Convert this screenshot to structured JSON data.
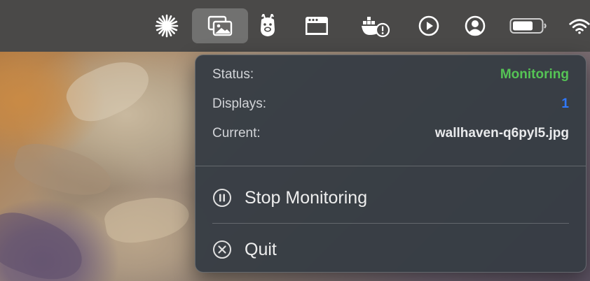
{
  "menubar": {
    "icons": [
      {
        "name": "asterisk-icon"
      },
      {
        "name": "wallpaper-app-icon",
        "active": true
      },
      {
        "name": "llama-icon"
      },
      {
        "name": "window-bar-icon"
      },
      {
        "name": "docker-warning-icon"
      },
      {
        "name": "play-circle-icon"
      },
      {
        "name": "user-circle-icon"
      },
      {
        "name": "battery-icon"
      },
      {
        "name": "wifi-icon"
      }
    ]
  },
  "menu": {
    "status_label": "Status:",
    "status_value": "Monitoring",
    "displays_label": "Displays:",
    "displays_value": "1",
    "current_label": "Current:",
    "current_value": "wallhaven-q6pyl5.jpg",
    "stop_label": "Stop Monitoring",
    "quit_label": "Quit"
  },
  "colors": {
    "status_green": "#55c455",
    "displays_blue": "#2f79ff",
    "menu_bg": "#363c44",
    "menubar_bg": "#4a4948"
  }
}
